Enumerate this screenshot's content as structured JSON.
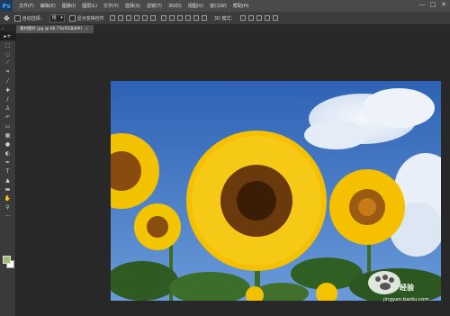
{
  "app": {
    "logo": "Ps"
  },
  "menu": [
    "文件(F)",
    "编辑(E)",
    "图像(I)",
    "图层(L)",
    "文字(Y)",
    "选择(S)",
    "滤镜(T)",
    "3D(D)",
    "视图(V)",
    "窗口(W)",
    "帮助(H)"
  ],
  "window_controls": [
    "—",
    "□",
    "✕"
  ],
  "options": {
    "auto_select_label": "自动选择：",
    "auto_select_value": "组",
    "show_transform_label": "显示变换控件",
    "mode_3d_label": "3D 模式："
  },
  "document_tab": {
    "title": "素材图片.jpg @ 66.7%(RGB/8#)",
    "close": "×"
  },
  "colors": {
    "foreground": "#9bc26a",
    "background": "#ffffff"
  },
  "watermark": {
    "text": "经验",
    "url": "jingyan.baidu.com"
  }
}
